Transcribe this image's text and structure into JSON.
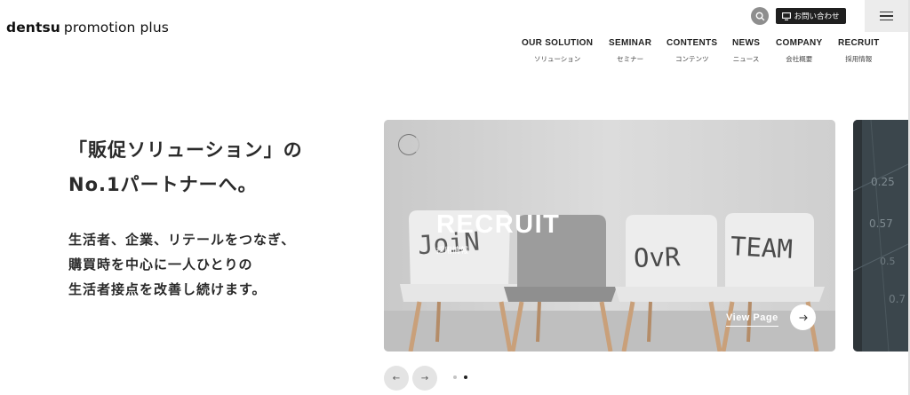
{
  "header": {
    "logo_brand": "dentsu",
    "logo_sub": "promotion plus",
    "contact_label": "お問い合わせ",
    "nav": [
      {
        "en": "OUR SOLUTION",
        "ja": "ソリューション"
      },
      {
        "en": "SEMINAR",
        "ja": "セミナー"
      },
      {
        "en": "CONTENTS",
        "ja": "コンテンツ"
      },
      {
        "en": "NEWS",
        "ja": "ニュース"
      },
      {
        "en": "COMPANY",
        "ja": "会社概要"
      },
      {
        "en": "RECRUIT",
        "ja": "採用情報"
      }
    ]
  },
  "hero": {
    "title_lines": [
      "「販促ソリューション」の",
      "No.1パートナーへ。"
    ],
    "body_lines": [
      "生活者、企業、リテールをつなぎ、",
      "購買時を中心に一人ひとりの",
      "生活者接点を改善し続けます。"
    ]
  },
  "carousel": {
    "slide_title": "RECRUIT",
    "slide_subtitle": "採用情報",
    "view_page_label": "View Page",
    "chair_words": [
      "JoiN",
      "OvR",
      "TEAM"
    ],
    "next_slide_numbers": [
      "0.25",
      "0.57",
      "0.5",
      "0.7"
    ],
    "prev_label": "←",
    "next_label": "→",
    "active_index": 1,
    "count": 2
  },
  "icons": {
    "search": "search-icon",
    "contact": "monitor-icon",
    "menu": "hamburger-icon",
    "arrow": "arrow-right-icon"
  },
  "colors": {
    "dark": "#1f1f1f",
    "search_bg": "#8e8e8e",
    "menu_bg": "#ececec",
    "slide_bg": "#d2d2d2",
    "next_slide_bg": "#2d3438"
  }
}
